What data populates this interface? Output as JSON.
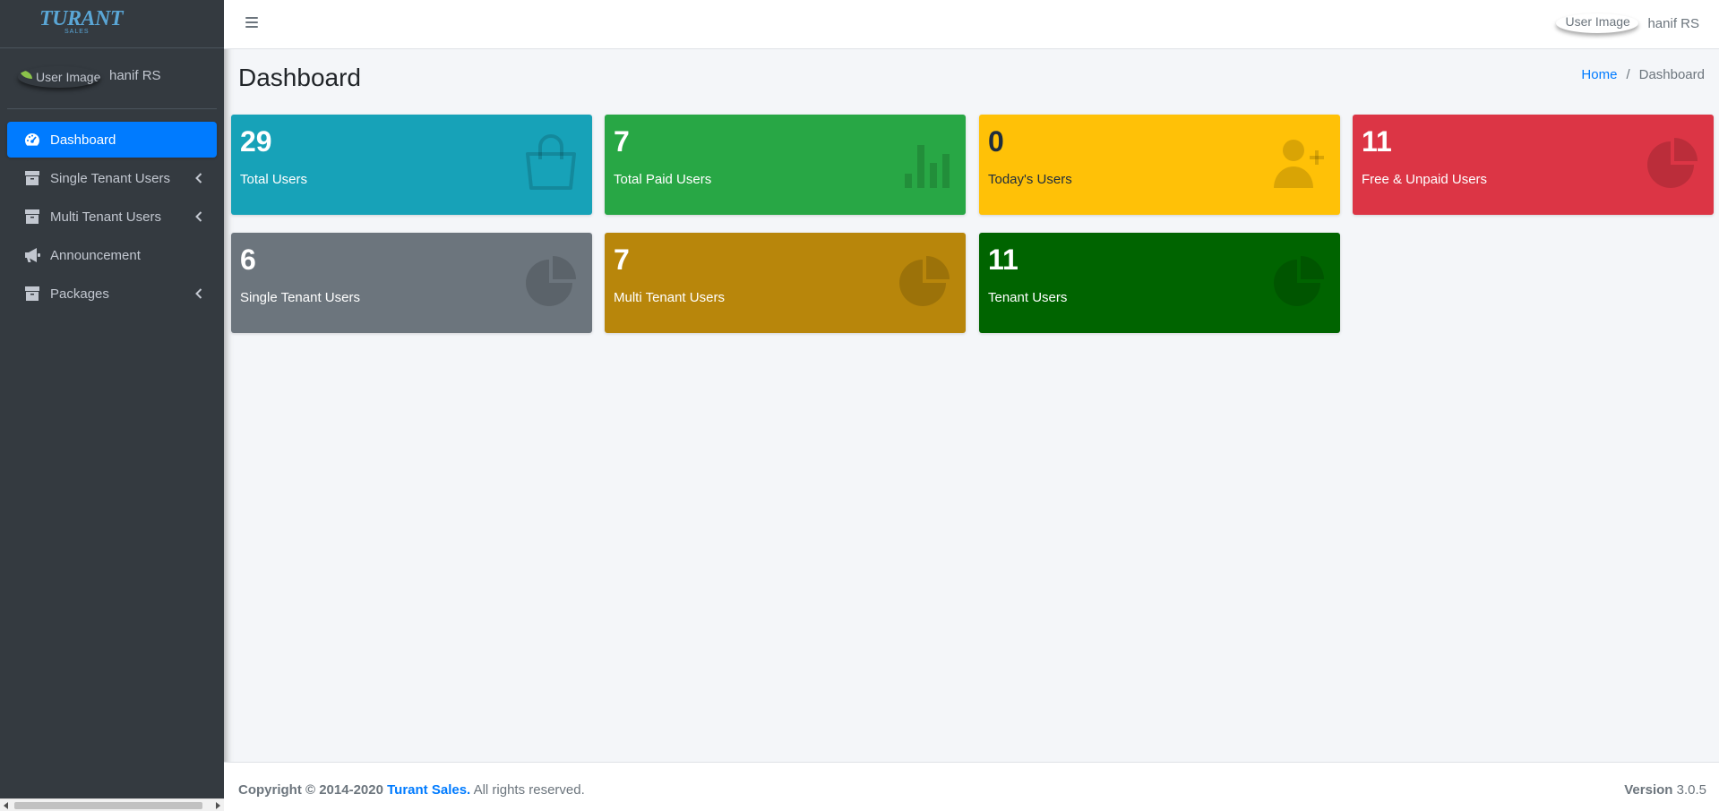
{
  "brand": {
    "name": "TURANT",
    "sub": "SALES"
  },
  "user": {
    "image_alt": "User Image",
    "name": "hanif RS"
  },
  "sidebar": {
    "items": [
      {
        "label": "Dashboard",
        "icon": "tachometer-icon",
        "active": true
      },
      {
        "label": "Single Tenant Users",
        "icon": "box-icon",
        "has_submenu": true
      },
      {
        "label": "Multi Tenant Users",
        "icon": "box-icon",
        "has_submenu": true
      },
      {
        "label": "Announcement",
        "icon": "bullhorn-icon"
      },
      {
        "label": "Packages",
        "icon": "box-icon",
        "has_submenu": true
      }
    ]
  },
  "header": {
    "menu_icon": "hamburger-icon",
    "user_image_alt": "User Image",
    "user_name": "hanif RS"
  },
  "content": {
    "title": "Dashboard",
    "breadcrumb": {
      "home": "Home",
      "separator": "/",
      "current": "Dashboard"
    }
  },
  "stats": [
    {
      "value": "29",
      "label": "Total Users",
      "color": "#17a2b8",
      "icon": "shopping-bag-icon"
    },
    {
      "value": "7",
      "label": "Total Paid Users",
      "color": "#28a745",
      "icon": "bar-chart-icon"
    },
    {
      "value": "0",
      "label": "Today's Users",
      "color": "#ffc107",
      "icon": "user-plus-icon"
    },
    {
      "value": "11",
      "label": "Free & Unpaid Users",
      "color": "#dc3545",
      "icon": "pie-chart-icon"
    },
    {
      "value": "6",
      "label": "Single Tenant Users",
      "color": "#6c757d",
      "icon": "pie-chart-icon"
    },
    {
      "value": "7",
      "label": "Multi Tenant Users",
      "color": "#b8860b",
      "icon": "pie-chart-icon"
    },
    {
      "value": "11",
      "label": "Tenant Users",
      "color": "#006400",
      "icon": "pie-chart-icon"
    }
  ],
  "footer": {
    "copyright_prefix": "Copyright © 2014-2020",
    "company": "Turant Sales.",
    "rights": "All rights reserved.",
    "version_label": "Version",
    "version_number": "3.0.5"
  }
}
